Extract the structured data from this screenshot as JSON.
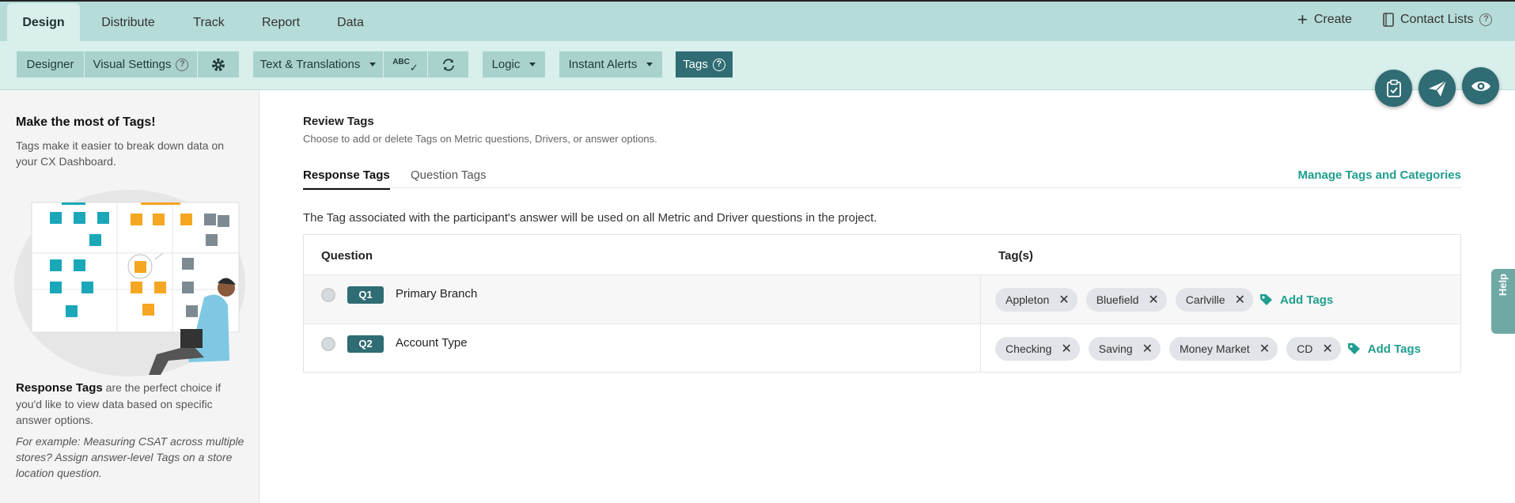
{
  "nav": {
    "tabs": [
      {
        "label": "Design",
        "active": true
      },
      {
        "label": "Distribute"
      },
      {
        "label": "Track"
      },
      {
        "label": "Report"
      },
      {
        "label": "Data"
      }
    ],
    "create_label": "Create",
    "contact_lists_label": "Contact Lists"
  },
  "toolbar": {
    "designer": "Designer",
    "visual_settings": "Visual Settings",
    "text_translations": "Text & Translations",
    "spellcheck_glyph": "ABC",
    "logic": "Logic",
    "instant_alerts": "Instant Alerts",
    "tags": "Tags"
  },
  "sidebar": {
    "title": "Make the most of Tags!",
    "intro": "Tags make it easier to break down data on your CX Dashboard.",
    "response_tags_bold": "Response Tags",
    "response_tags_text": " are the perfect choice if you'd like to view data based on specific answer options.",
    "example": "For example: Measuring CSAT across multiple stores? Assign answer-level Tags on a store location question."
  },
  "main": {
    "title": "Review Tags",
    "subtitle": "Choose to add or delete Tags on Metric questions, Drivers, or answer options.",
    "tabs": [
      "Response Tags",
      "Question Tags"
    ],
    "manage_link": "Manage Tags and Categories",
    "description": "The Tag associated with the participant's answer will be used on all Metric and Driver questions in the project.",
    "table": {
      "headers": [
        "Question",
        "Tag(s)"
      ],
      "rows": [
        {
          "badge": "Q1",
          "question": "Primary Branch",
          "tags": [
            "Appleton",
            "Bluefield",
            "Carlville"
          ],
          "add_label": "Add Tags"
        },
        {
          "badge": "Q2",
          "question": "Account Type",
          "tags": [
            "Checking",
            "Saving",
            "Money Market",
            "CD"
          ],
          "add_label": "Add Tags"
        }
      ]
    }
  },
  "help_label": "Help",
  "colors": {
    "nav_bg": "#b5dcd8",
    "toolbar_bg": "#d8efec",
    "accent_dark": "#2f6c73",
    "link_teal": "#1f9e8f"
  }
}
